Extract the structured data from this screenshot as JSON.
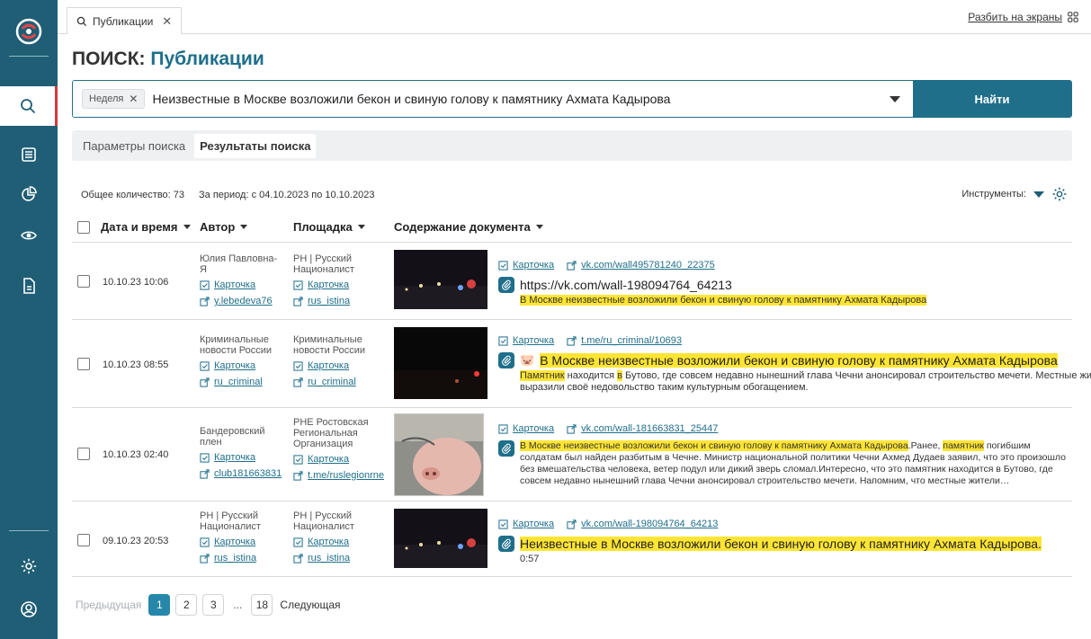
{
  "tabbar": {
    "tab_label": "Публикации",
    "split_label": "Разбить на экраны"
  },
  "page_title": {
    "prefix": "ПОИСК:",
    "name": "Публикации"
  },
  "search": {
    "chip_label": "Неделя",
    "query": "Неизвестные в Москве возложили бекон и свиную голову к памятнику Ахмата Кадырова",
    "find_label": "Найти"
  },
  "subtabs": [
    "Параметры поиска",
    "Результаты поиска"
  ],
  "results": {
    "total": "Общее количество: 73",
    "period": "За период: с 04.10.2023 по 10.10.2023",
    "tools_label": "Инструменты:"
  },
  "columns": {
    "date": "Дата и время",
    "author": "Автор",
    "platform": "Площадка",
    "content": "Содержание документа"
  },
  "rows": [
    {
      "date": "10.10.23 10:06",
      "author_name": "Юлия Павловна-Я",
      "author_card": "Карточка",
      "author_link": "y.lebedeva76",
      "platform_name": "РН | Русский Националист",
      "platform_card": "Карточка",
      "platform_link": "rus_istina",
      "card": "Карточка",
      "url": "vk.com/wall495781240_22375",
      "doc_title": "https://vk.com/wall-198094764_64213",
      "snippet": "В Москве неизвестные возложили бекон и свиную голову к памятнику Ахмата Кадырова"
    },
    {
      "date": "10.10.23 08:55",
      "author_name": "Криминальные новости России",
      "author_card": "Карточка",
      "author_link": "ru_criminal",
      "platform_name": "Криминальные новости России",
      "platform_card": "Карточка",
      "platform_link": "ru_criminal",
      "card": "Карточка",
      "url": "t.me/ru_criminal/10693",
      "doc_title": "В Москве неизвестные возложили бекон и свиную голову к памятнику Ахмата Кадырова",
      "snippet_hl1": "Памятник",
      "snippet_mid": " находится ",
      "snippet_hl2": "в",
      "snippet_rest": " Бутово, где совсем недавно нынешний глава Чечни анонсировал строительство мечети. Местные жители выразили своё недовольство таким культурным обогащением."
    },
    {
      "date": "10.10.23 02:40",
      "author_name": "Бандеровский плен",
      "author_card": "Карточка",
      "author_link": "club181663831",
      "platform_name": "РНЕ Ростовская Региональная Организация",
      "platform_card": "Карточка",
      "platform_link": "t.me/ruslegionrne",
      "card": "Карточка",
      "url": "vk.com/wall-181663831_25447",
      "snippet_hl1": "В Москве неизвестные возложили бекон и свиную голову к памятнику Ахмата Кадырова",
      "snippet_mid": ".Ранее, ",
      "snippet_hl2": "памятник",
      "snippet_rest": " погибшим солдатам был найден разбитым в Чечне. Министр национальной политики Чечни Ахмед Дудаев заявил, что это произошло без вмешательства человека, ветер подул или дикий зверь сломал.Интересно, что это памятник находится в Бутово, где совсем недавно нынешний глава Чечни анонсировал строительство мечети. Напомним, что местные жители…"
    },
    {
      "date": "09.10.23 20:53",
      "author_name": "РН | Русский Националист",
      "author_card": "Карточка",
      "author_link": "rus_istina",
      "platform_name": "РН | Русский Националист",
      "platform_card": "Карточка",
      "platform_link": "rus_istina",
      "card": "Карточка",
      "url": "vk.com/wall-198094764_64213",
      "doc_title": "Неизвестные в Москве возложили бекон и свиную голову к памятнику Ахмата Кадырова.",
      "duration": "0:57"
    }
  ],
  "pager": {
    "prev": "Предыдущая",
    "pages": [
      "1",
      "2",
      "3",
      "...",
      "18"
    ],
    "next": "Следующая"
  },
  "colors": {
    "sidebar": "#1f5e75",
    "accent": "#1f6f8b",
    "highlight": "#ffe533",
    "active_page": "#2787ab"
  }
}
